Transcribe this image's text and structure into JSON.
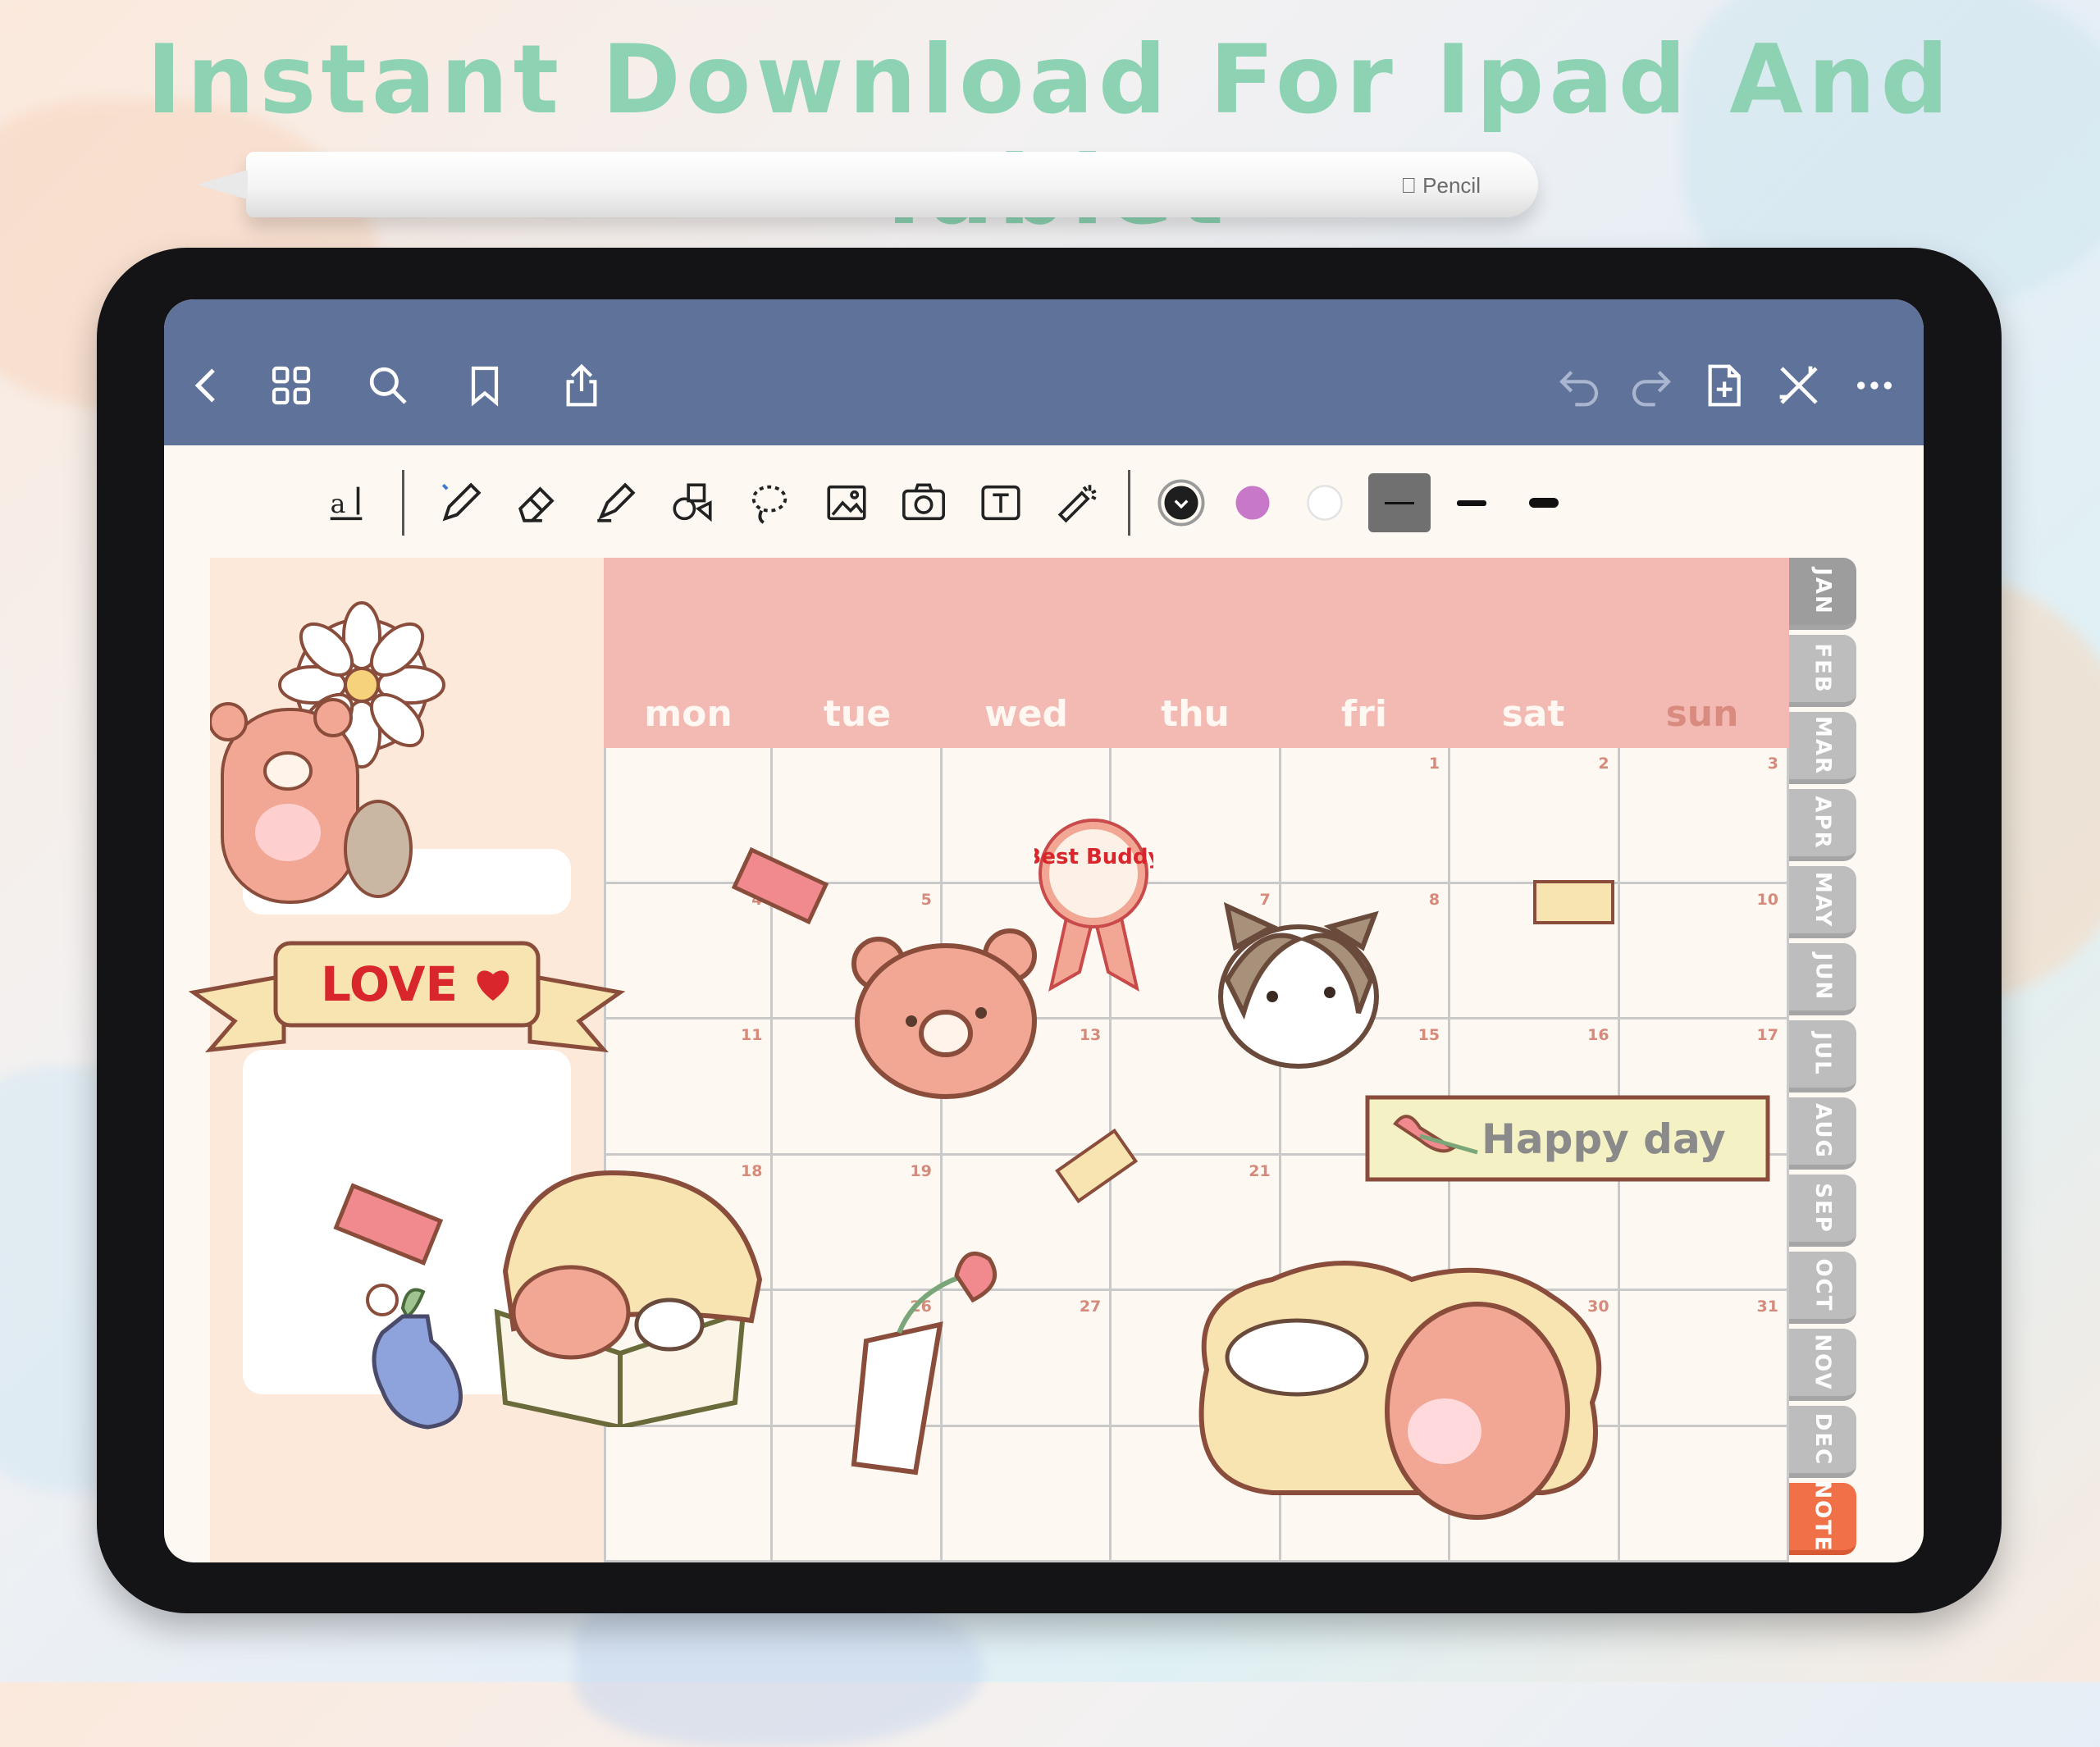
{
  "headline": "Instant Download For Ipad And Tablet",
  "pencil": {
    "brand": "Pencil"
  },
  "navbar": {
    "icons": [
      "back-chevron-icon",
      "grid-icon",
      "search-icon",
      "bookmark-icon",
      "share-icon",
      "undo-icon",
      "redo-icon",
      "add-page-icon",
      "close-icon",
      "more-icon"
    ]
  },
  "toolbar": {
    "tools": [
      "handwriting-conversion-icon",
      "pen-icon",
      "eraser-icon",
      "highlighter-icon",
      "shapes-icon",
      "lasso-icon",
      "image-icon",
      "camera-icon",
      "text-box-icon",
      "laser-pointer-icon"
    ],
    "colors": [
      "#1e1e1e",
      "#c878c8",
      "#ffffff"
    ],
    "stroke_widths": [
      "thin",
      "medium",
      "thick"
    ]
  },
  "planner": {
    "days": [
      "mon",
      "tue",
      "wed",
      "thu",
      "fri",
      "sat",
      "sun"
    ],
    "weeks": [
      [
        "",
        "",
        "",
        "",
        "1",
        "2",
        "3"
      ],
      [
        "4",
        "5",
        "",
        "7",
        "8",
        "",
        "10"
      ],
      [
        "11",
        "",
        "13",
        "",
        "15",
        "16",
        "17"
      ],
      [
        "18",
        "19",
        "",
        "21",
        "",
        "",
        ""
      ],
      [
        "",
        "26",
        "27",
        "",
        "",
        "30",
        "31"
      ],
      [
        "",
        "",
        "",
        "",
        "",
        "",
        ""
      ]
    ],
    "months": [
      "JAN",
      "FEB",
      "MAR",
      "APR",
      "MAY",
      "JUN",
      "JUL",
      "AUG",
      "SEP",
      "OCT",
      "NOV",
      "DEC",
      "NOTE"
    ],
    "accent": "#f2bab3",
    "side_color": "#fde9da"
  },
  "stickers": {
    "love_banner": "LOVE",
    "best_buddy": "Best Buddy",
    "happy_day": "Happy day"
  }
}
